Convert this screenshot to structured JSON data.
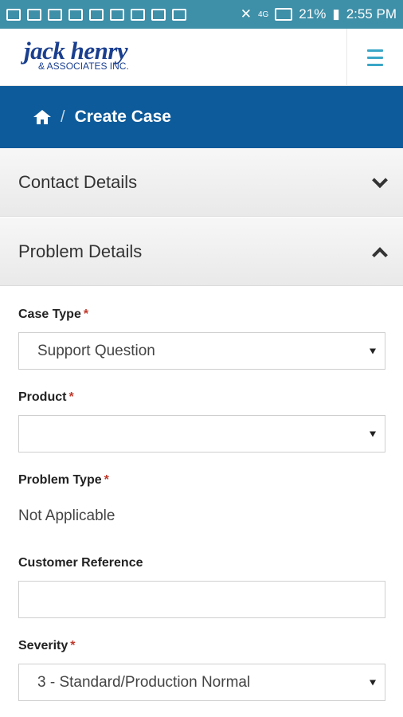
{
  "status": {
    "battery": "21%",
    "time": "2:55 PM",
    "network": "4G"
  },
  "header": {
    "logo_main": "jack henry",
    "logo_sub": "& ASSOCIATES INC."
  },
  "breadcrumb": {
    "separator": "/",
    "title": "Create Case"
  },
  "panels": {
    "contact": {
      "title": "Contact Details"
    },
    "problem": {
      "title": "Problem Details"
    }
  },
  "form": {
    "case_type": {
      "label": "Case Type",
      "required": "*",
      "value": "Support Question"
    },
    "product": {
      "label": "Product",
      "required": "*",
      "value": ""
    },
    "problem_type": {
      "label": "Problem Type",
      "required": "*",
      "value": "Not Applicable"
    },
    "customer_reference": {
      "label": "Customer Reference",
      "value": ""
    },
    "severity": {
      "label": "Severity",
      "required": "*",
      "value": "3 - Standard/Production Normal"
    }
  },
  "colors": {
    "status_bar": "#3e8fa8",
    "brand": "#1a3f8f",
    "breadcrumb_bg": "#0d5b9a",
    "menu_icon": "#3aa6c7",
    "required": "#c0392b"
  }
}
